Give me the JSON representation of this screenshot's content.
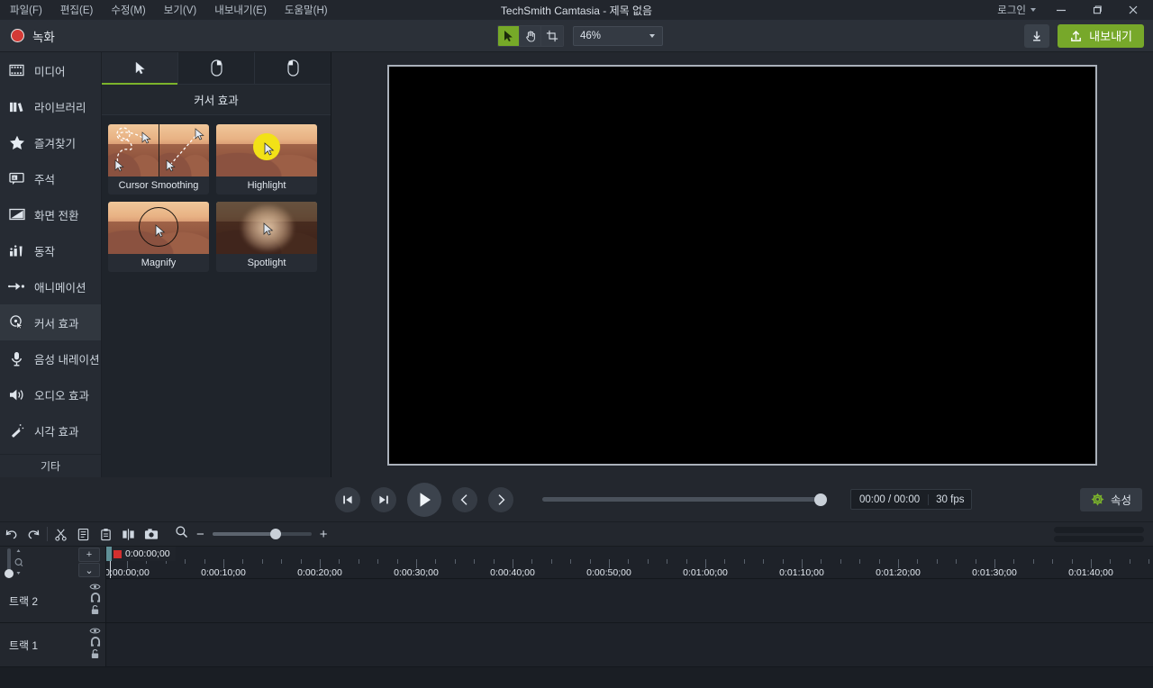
{
  "titlebar": {
    "menu": [
      {
        "label": "파일(F)",
        "name": "menu-file"
      },
      {
        "label": "편집(E)",
        "name": "menu-edit"
      },
      {
        "label": "수정(M)",
        "name": "menu-modify"
      },
      {
        "label": "보기(V)",
        "name": "menu-view"
      },
      {
        "label": "내보내기(E)",
        "name": "menu-export"
      },
      {
        "label": "도움말(H)",
        "name": "menu-help"
      }
    ],
    "window_title": "TechSmith Camtasia - 제목 없음",
    "login_label": "로그인",
    "minimize_label": "—",
    "maximize_label": "❐",
    "close_label": "✕"
  },
  "toolbar": {
    "record_label": "녹화",
    "tools": [
      {
        "label": "select-tool",
        "active": true
      },
      {
        "label": "hand-tool",
        "active": false
      },
      {
        "label": "crop-tool",
        "active": false
      }
    ],
    "zoom_value": "46%",
    "export_label": "내보내기"
  },
  "sidebar": {
    "items": [
      {
        "label": "미디어",
        "icon": "media-icon"
      },
      {
        "label": "라이브러리",
        "icon": "library-icon"
      },
      {
        "label": "즐겨찾기",
        "icon": "favorites-star-icon"
      },
      {
        "label": "주석",
        "icon": "annotation-icon"
      },
      {
        "label": "화면 전환",
        "icon": "transitions-icon"
      },
      {
        "label": "동작",
        "icon": "behaviors-icon"
      },
      {
        "label": "애니메이션",
        "icon": "animations-arrow-icon"
      },
      {
        "label": "커서 효과",
        "icon": "cursor-effects-icon",
        "active": true
      },
      {
        "label": "음성 내레이션",
        "icon": "microphone-icon"
      },
      {
        "label": "오디오 효과",
        "icon": "speaker-icon"
      },
      {
        "label": "시각 효과",
        "icon": "magic-wand-icon"
      }
    ],
    "other_label": "기타"
  },
  "panel": {
    "tabs": [
      {
        "name": "tab-cursor",
        "icon": "cursor-arrow-icon",
        "active": true
      },
      {
        "name": "tab-right-click",
        "icon": "mouse-right-click-icon",
        "active": false
      },
      {
        "name": "tab-left-click",
        "icon": "mouse-left-click-icon",
        "active": false
      }
    ],
    "title": "커서 효과",
    "effects": [
      {
        "label": "Cursor Smoothing",
        "kind": "smoothing"
      },
      {
        "label": "Highlight",
        "kind": "highlight"
      },
      {
        "label": "Magnify",
        "kind": "magnify"
      },
      {
        "label": "Spotlight",
        "kind": "spotlight"
      }
    ]
  },
  "playback": {
    "prev_frame": "prev-frame",
    "next_frame": "next-frame",
    "play": "play",
    "prev_marker": "prev-marker",
    "next_marker": "next-marker",
    "time_display": "00:00 / 00:00",
    "fps": "30 fps",
    "properties_label": "속성"
  },
  "timeline": {
    "toolbar_icons": [
      "undo-icon",
      "redo-icon",
      "cut-icon",
      "copy-icon",
      "paste-icon",
      "split-icon",
      "snapshot-icon"
    ],
    "zoom_icon": "zoom-search-icon",
    "zoom_out_label": "−",
    "zoom_in_label": "+",
    "playhead_time": "0:00:00;00",
    "ruler_labels": [
      "0:00:00;00",
      "0:00:10;00",
      "0:00:20;00",
      "0:00:30;00",
      "0:00:40;00",
      "0:00:50;00",
      "0:01:00;00",
      "0:01:10;00",
      "0:01:20;00",
      "0:01:30;00",
      "0:01:40;00"
    ],
    "tracks": [
      {
        "label": "트랙 2",
        "icons": [
          "eye-icon",
          "magnet-icon",
          "lock-icon"
        ]
      },
      {
        "label": "트랙 1",
        "icons": [
          "eye-icon",
          "magnet-icon",
          "lock-icon"
        ]
      }
    ],
    "add_track_label": "+",
    "collapse_label": "⌄"
  },
  "colors": {
    "accent_green": "#77a82a",
    "record_red": "#d33a36",
    "highlight_yellow": "#f2e117",
    "panel_bg": "#1f242b",
    "chrome_bg": "#23272e"
  }
}
